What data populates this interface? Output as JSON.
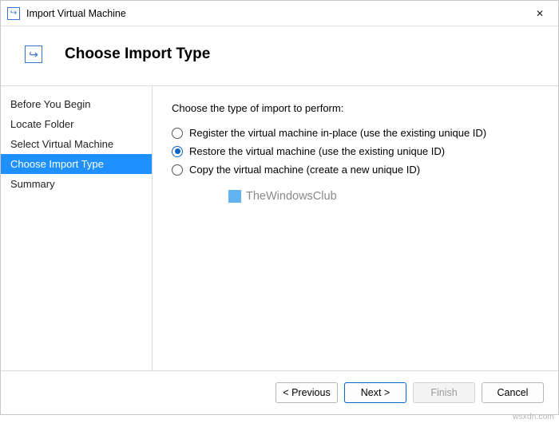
{
  "window": {
    "title": "Import Virtual Machine",
    "close_symbol": "✕"
  },
  "header": {
    "icon_glyph": "↪",
    "title": "Choose Import Type"
  },
  "sidebar": {
    "items": [
      {
        "label": "Before You Begin",
        "active": false
      },
      {
        "label": "Locate Folder",
        "active": false
      },
      {
        "label": "Select Virtual Machine",
        "active": false
      },
      {
        "label": "Choose Import Type",
        "active": true
      },
      {
        "label": "Summary",
        "active": false
      }
    ]
  },
  "content": {
    "prompt": "Choose the type of import to perform:",
    "options": [
      {
        "label": "Register the virtual machine in-place (use the existing unique ID)",
        "selected": false
      },
      {
        "label": "Restore the virtual machine (use the existing unique ID)",
        "selected": true
      },
      {
        "label": "Copy the virtual machine (create a new unique ID)",
        "selected": false
      }
    ]
  },
  "watermark": {
    "text": "TheWindowsClub"
  },
  "footer": {
    "previous": "< Previous",
    "next": "Next >",
    "finish": "Finish",
    "cancel": "Cancel"
  },
  "credit": "wsxdn.com"
}
